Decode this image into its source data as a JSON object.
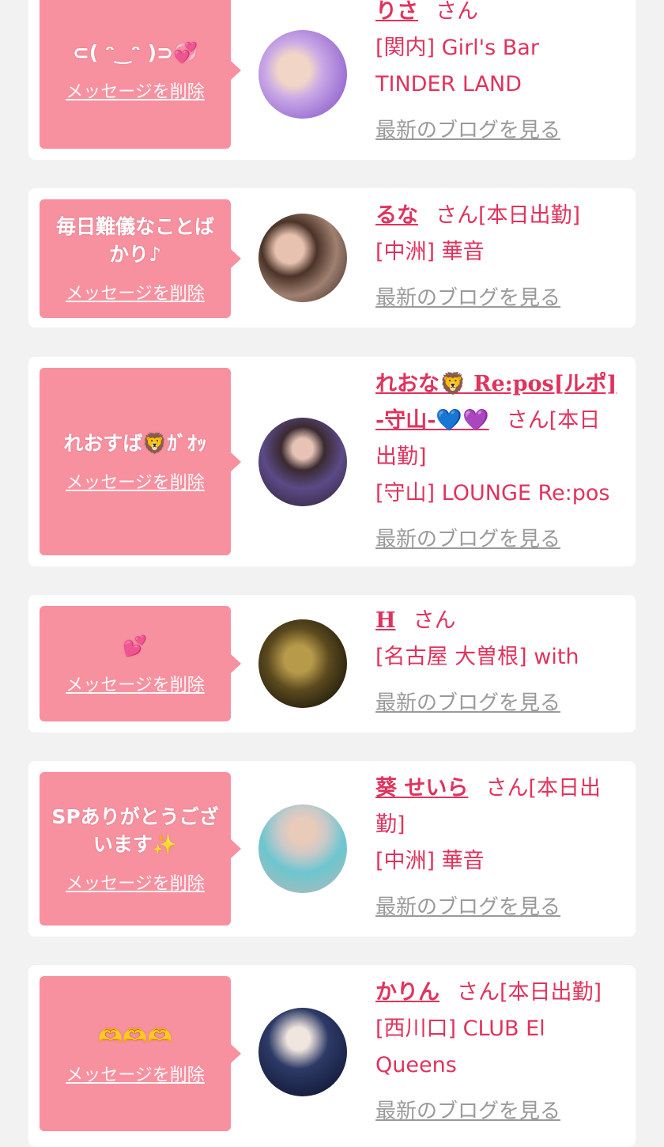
{
  "delete_label": "メッセージを削除",
  "blog_label": "最新のブログを見る",
  "san_label": "さん",
  "items": [
    {
      "message": "⊂( ᵔ‿ᵔ )⊃💞",
      "name": "りさ",
      "after_san": "",
      "shop": "[関内] Girl's Bar TINDER LAND"
    },
    {
      "message": "毎日難儀なことばかり♪",
      "name": "るな",
      "after_san": "[本日出勤]",
      "shop": "[中洲] 華音"
    },
    {
      "message": "れおすば🦁ｶﾞｵｯ",
      "name": "れおな🦁 Re:pos[ルポ] -守山-💙💜",
      "after_san": "[本日出勤]",
      "shop": "[守山] LOUNGE Re:pos"
    },
    {
      "message": "💕",
      "name": "H",
      "after_san": "",
      "shop": "[名古屋 大曽根] with"
    },
    {
      "message": "SPありがとうございます✨",
      "name": "葵 せいら",
      "after_san": "[本日出勤]",
      "shop": "[中洲] 華音"
    },
    {
      "message": "🫶🫶🫶",
      "name": "かりん",
      "after_san": "[本日出勤]",
      "shop": "[西川口] CLUB El Queens"
    }
  ],
  "colors": {
    "accent": "#e0335d",
    "bubble": "#f7909f",
    "background": "#f2f2f2"
  }
}
